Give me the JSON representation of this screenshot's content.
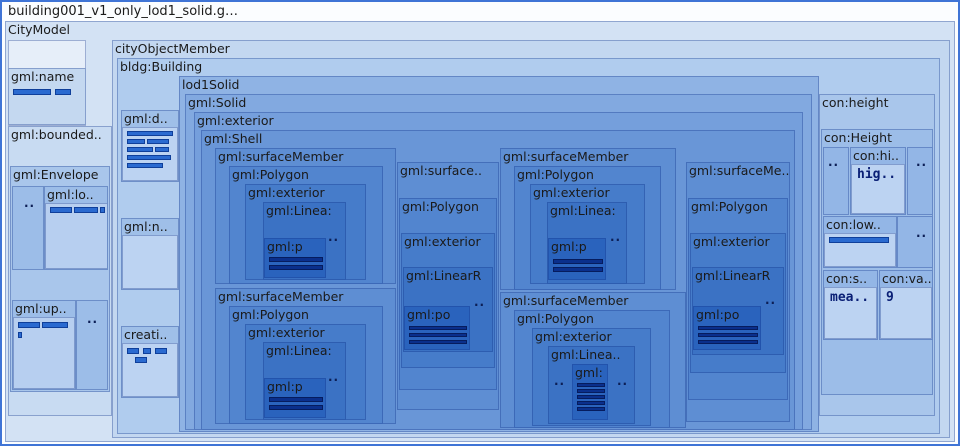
{
  "labels": {
    "root": "building001_v1_only_lod1_solid.g…",
    "citymodel": "CityModel",
    "gml_name": "gml:name",
    "gml_bounded": "gml:bounded..",
    "gml_envelope": "gml:Envelope",
    "gml_lower": "gml:lo..",
    "gml_upper": "gml:up..",
    "cityobjectmember": "cityObjectMember",
    "bldg_building": "bldg:Building",
    "gml_d": "gml:d..",
    "gml_n": "gml:n..",
    "creation": "creati..",
    "lod1solid": "lod1Solid",
    "gml_solid": "gml:Solid",
    "gml_exterior": "gml:exterior",
    "gml_shell": "gml:Shell",
    "sm1": "gml:surfaceMember",
    "sm1_polygon": "gml:Polygon",
    "sm1_exterior": "gml:exterior",
    "sm1_linear": "gml:Linea:",
    "sm1_pos": "gml:p",
    "sm2": "gml:surfaceMember",
    "sm2_polygon": "gml:Polygon",
    "sm2_exterior": "gml:exterior",
    "sm2_linear": "gml:Linea:",
    "sm2_pos": "gml:p",
    "sm3": "gml:surface..",
    "sm3_polygon": "gml:Polygon",
    "sm3_exterior": "gml:exterior",
    "sm3_linear": "gml:LinearR",
    "sm3_pos": "gml:po",
    "sm4": "gml:surfaceMember",
    "sm4_polygon": "gml:Polygon",
    "sm4_exterior": "gml:exterior",
    "sm4_linear": "gml:Linea:",
    "sm4_pos": "gml:p",
    "sm5": "gml:surfaceMember",
    "sm5_polygon": "gml:Polygon",
    "sm5_exterior": "gml:exterior",
    "sm5_linear": "gml:Linea..",
    "sm5_pos": "gml:",
    "sm6": "gml:surfaceMe..",
    "sm6_polygon": "gml:Polygon",
    "sm6_exterior": "gml:exterior",
    "sm6_linear": "gml:LinearR",
    "sm6_pos": "gml:po",
    "con_height": "con:height",
    "con_height_cls": "con:Height",
    "con_hi": "con:hi..",
    "con_low": "con:low..",
    "con_s": "con:s..",
    "con_va": "con:va.."
  },
  "values": {
    "hi_val": "hig..",
    "s_val": "mea..",
    "va_val": "9"
  },
  "colors": {
    "frame_border": "#3f74d6",
    "title_bg": "#ffffff",
    "level_fill": "#5a8fd8",
    "bar": "#2a6ad0",
    "bar_dark": "#0a2f8c"
  }
}
